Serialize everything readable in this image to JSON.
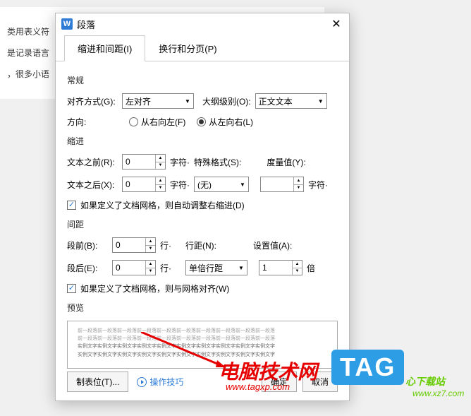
{
  "bg": {
    "line1": "类用表义符",
    "line2": "是记录语言",
    "line3": "，很多小语"
  },
  "dialog": {
    "title": "段落",
    "tabs": [
      {
        "label": "缩进和间距(I)",
        "active": true
      },
      {
        "label": "换行和分页(P)",
        "active": false
      }
    ],
    "sections": {
      "general": "常规",
      "indent": "缩进",
      "spacing": "间距",
      "preview": "预览"
    },
    "general": {
      "align_label": "对齐方式(G):",
      "align_value": "左对齐",
      "outline_label": "大纲级别(O):",
      "outline_value": "正文文本",
      "direction_label": "方向:",
      "rtl_label": "从右向左(F)",
      "ltr_label": "从左向右(L)",
      "direction_selected": "ltr"
    },
    "indent": {
      "before_label": "文本之前(R):",
      "before_value": "0",
      "before_unit": "字符·",
      "after_label": "文本之后(X):",
      "after_value": "0",
      "after_unit": "字符·",
      "special_label": "特殊格式(S):",
      "special_value": "(无)",
      "measure_label": "度量值(Y):",
      "measure_value": "",
      "measure_unit": "字符·",
      "auto_adjust": "如果定义了文档网格，则自动调整右缩进(D)"
    },
    "spacing": {
      "before_label": "段前(B):",
      "before_value": "0",
      "before_unit": "行·",
      "after_label": "段后(E):",
      "after_value": "0",
      "after_unit": "行·",
      "line_label": "行距(N):",
      "line_value": "单倍行距",
      "setvalue_label": "设置值(A):",
      "setvalue_value": "1",
      "setvalue_unit": "倍",
      "snap_grid": "如果定义了文档网格，则与网格对齐(W)"
    },
    "preview_text": {
      "l1": "前一段落前一段落前一段落前一段落前一段落前一段落前一段落前一段落前一段落前一段落",
      "l2": "前一段落前一段落前一段落前一段落前一段落前一段落前一段落前一段落前一段落前一段落",
      "l3": "实例文字实例文字实例文字实例文字实例文字实例文字实例文字实例文字实例文字实例文字",
      "l4": "实例文字实例文字实例文字实例文字实例文字实例文字实例文字实例文字实例文字实例文字"
    },
    "footer": {
      "tabstop": "制表位(T)...",
      "tips": "操作技巧",
      "ok": "确定",
      "cancel": "取消"
    }
  },
  "overlays": {
    "wm1": "电脑技术网",
    "wm1_url": "www.tagxp.com",
    "tag": "TAG",
    "wm2": "心下载站",
    "wm2_url": "www.xz7.com"
  }
}
